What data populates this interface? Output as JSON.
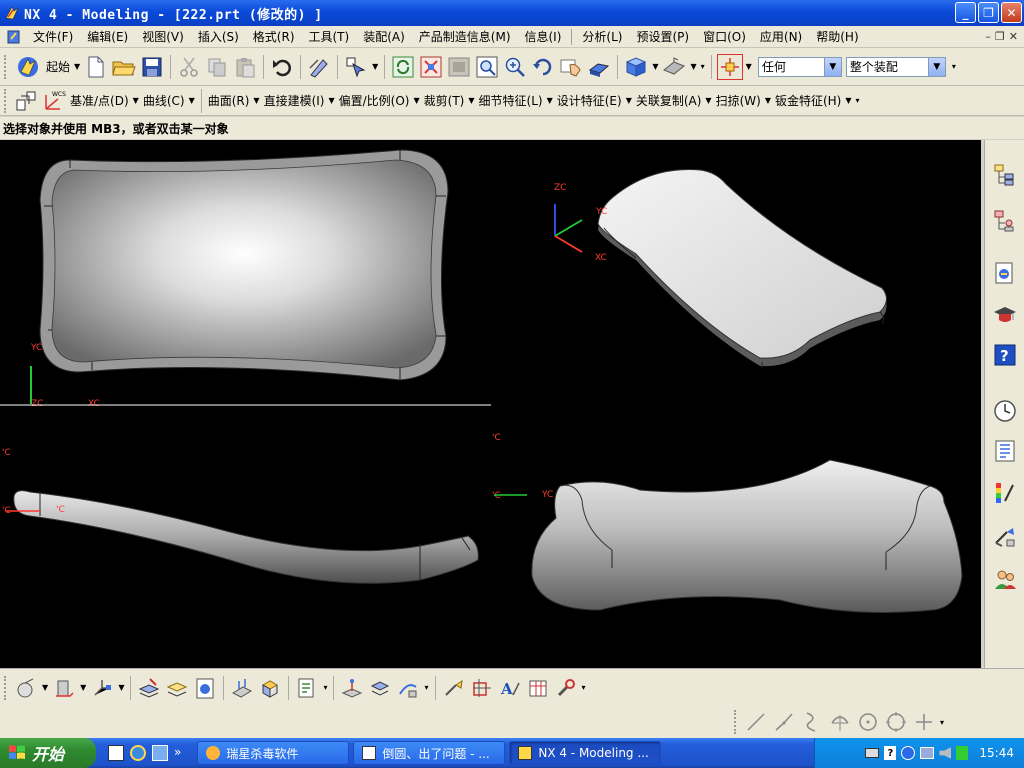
{
  "window": {
    "title": "NX 4 - Modeling - [222.prt  (修改的) ]",
    "controls": {
      "minimize": "_",
      "restore": "❐",
      "close": "✕"
    }
  },
  "menu": {
    "items": [
      "文件(F)",
      "编辑(E)",
      "视图(V)",
      "插入(S)",
      "格式(R)",
      "工具(T)",
      "装配(A)",
      "产品制造信息(M)",
      "信息(I)",
      "分析(L)",
      "预设置(P)",
      "窗口(O)",
      "应用(N)",
      "帮助(H)"
    ]
  },
  "toolbar1": {
    "start_label": "起始",
    "filter_value": "任何",
    "assembly_scope_value": "整个装配"
  },
  "toolbar2": {
    "items": [
      "基准/点(D)",
      "曲线(C)",
      "曲面(R)",
      "直接建模(I)",
      "偏置/比例(O)",
      "裁剪(T)",
      "细节特征(L)",
      "设计特征(E)",
      "关联复制(A)",
      "扫掠(W)",
      "钣金特征(H)"
    ]
  },
  "status": {
    "prompt": "选择对象并使用 MB3，或者双击某一对象"
  },
  "viewport": {
    "axis_labels": {
      "zc": "ZC",
      "yc": "YC",
      "xc": "XC",
      "c_trunc": "'C"
    }
  },
  "taskbar": {
    "start_label": "开始",
    "overflow": "»",
    "tasks": [
      {
        "label": "瑞星杀毒软件"
      },
      {
        "label": "倒圆、出了问题 - ..."
      },
      {
        "label": "NX 4 - Modeling ..."
      }
    ],
    "clock": "15:44"
  },
  "colors": {
    "titlebar": "#0b4ad9",
    "viewport_bg": "#000000",
    "axis_red": "#ff3b2f",
    "axis_green": "#22cc33",
    "axis_blue": "#3355ff"
  }
}
